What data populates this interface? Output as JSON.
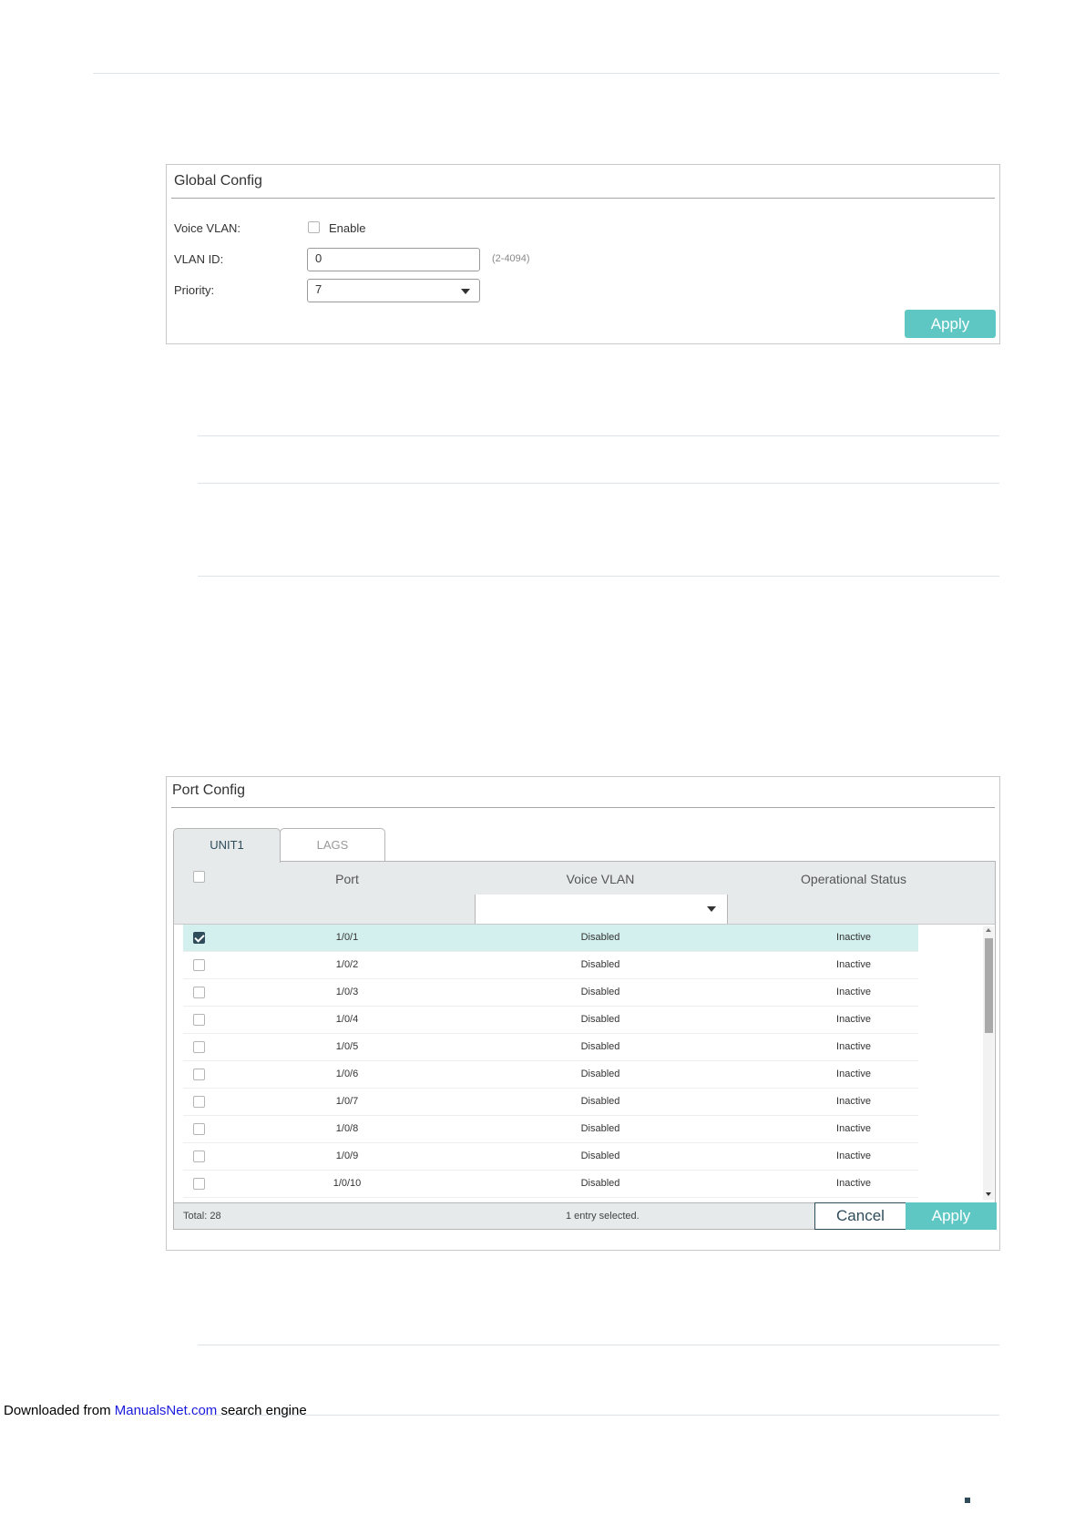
{
  "global_config": {
    "title": "Global Config",
    "voice_vlan_label": "Voice VLAN:",
    "enable_label": "Enable",
    "enable_checked": false,
    "vlan_id_label": "VLAN ID:",
    "vlan_id_value": "0",
    "vlan_id_hint": "(2-4094)",
    "priority_label": "Priority:",
    "priority_value": "7",
    "apply_label": "Apply"
  },
  "port_config": {
    "title": "Port Config",
    "tabs": [
      {
        "label": "UNIT1",
        "active": true
      },
      {
        "label": "LAGS",
        "active": false
      }
    ],
    "columns": {
      "port": "Port",
      "voice_vlan": "Voice VLAN",
      "status": "Operational Status"
    },
    "filter_voice_vlan_value": "",
    "rows": [
      {
        "port": "1/0/1",
        "voice_vlan": "Disabled",
        "status": "Inactive",
        "checked": true
      },
      {
        "port": "1/0/2",
        "voice_vlan": "Disabled",
        "status": "Inactive",
        "checked": false
      },
      {
        "port": "1/0/3",
        "voice_vlan": "Disabled",
        "status": "Inactive",
        "checked": false
      },
      {
        "port": "1/0/4",
        "voice_vlan": "Disabled",
        "status": "Inactive",
        "checked": false
      },
      {
        "port": "1/0/5",
        "voice_vlan": "Disabled",
        "status": "Inactive",
        "checked": false
      },
      {
        "port": "1/0/6",
        "voice_vlan": "Disabled",
        "status": "Inactive",
        "checked": false
      },
      {
        "port": "1/0/7",
        "voice_vlan": "Disabled",
        "status": "Inactive",
        "checked": false
      },
      {
        "port": "1/0/8",
        "voice_vlan": "Disabled",
        "status": "Inactive",
        "checked": false
      },
      {
        "port": "1/0/9",
        "voice_vlan": "Disabled",
        "status": "Inactive",
        "checked": false
      },
      {
        "port": "1/0/10",
        "voice_vlan": "Disabled",
        "status": "Inactive",
        "checked": false
      }
    ],
    "total_label": "Total: 28",
    "selection_label": "1 entry selected.",
    "cancel_label": "Cancel",
    "apply_label": "Apply"
  },
  "footer": {
    "prefix": "Downloaded from ",
    "link": "ManualsNet.com",
    "suffix": " search engine"
  },
  "colors": {
    "accent": "#5ec7c4",
    "dark": "#2f4c5a",
    "selected_row": "#d3f0ee",
    "header_bg": "#e6eaeb"
  }
}
